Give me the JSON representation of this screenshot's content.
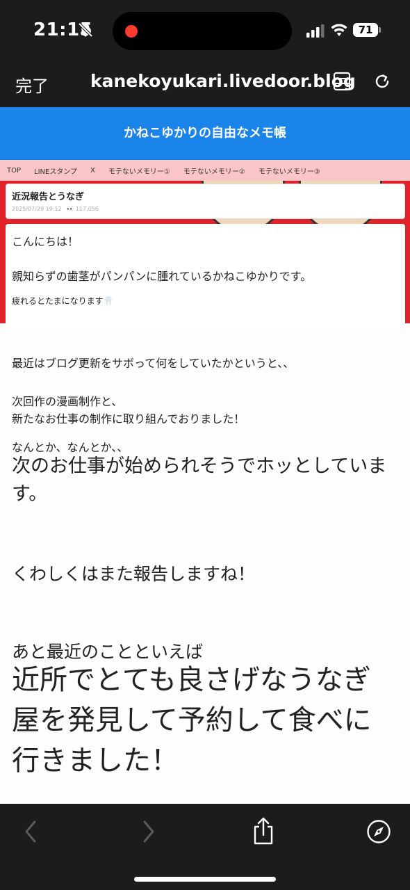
{
  "status": {
    "time": "21:15",
    "battery": "71"
  },
  "browser": {
    "done_label": "完了",
    "url": "kanekoyukari.livedoor.blog"
  },
  "blog": {
    "title": "かねこゆかりの自由なメモ帳",
    "nav": [
      "TOP",
      "LINEスタンプ",
      "X",
      "モテないメモリー①",
      "モテないメモリー②",
      "モテないメモリー③"
    ]
  },
  "post": {
    "title": "近況報告とうなぎ",
    "date": "2025/07/29 19:12",
    "views": "117,056"
  },
  "body": {
    "greeting": "こんにちは！",
    "line1": "親知らずの歯茎がパンパンに腫れているかねこゆかりです。",
    "line2": "疲れるとたまになります🦷",
    "line3": "最近はブログ更新をサボって何をしていたかというと、、",
    "line4": "次回作の漫画制作と、",
    "line5": "新たなお仕事の制作に取り組んでおりました！",
    "line6": "なんとか、なんとか、、",
    "line7a": "次のお仕事が始められそうでホッとしていま",
    "line7b": "す。",
    "line8": "くわしくはまた報告しますね！",
    "line9": "あと最近のことといえば",
    "line10a": "近所でとても良さげなうなぎ",
    "line10b": "屋を発見して予約して食べに",
    "line10c": "行きました！"
  }
}
